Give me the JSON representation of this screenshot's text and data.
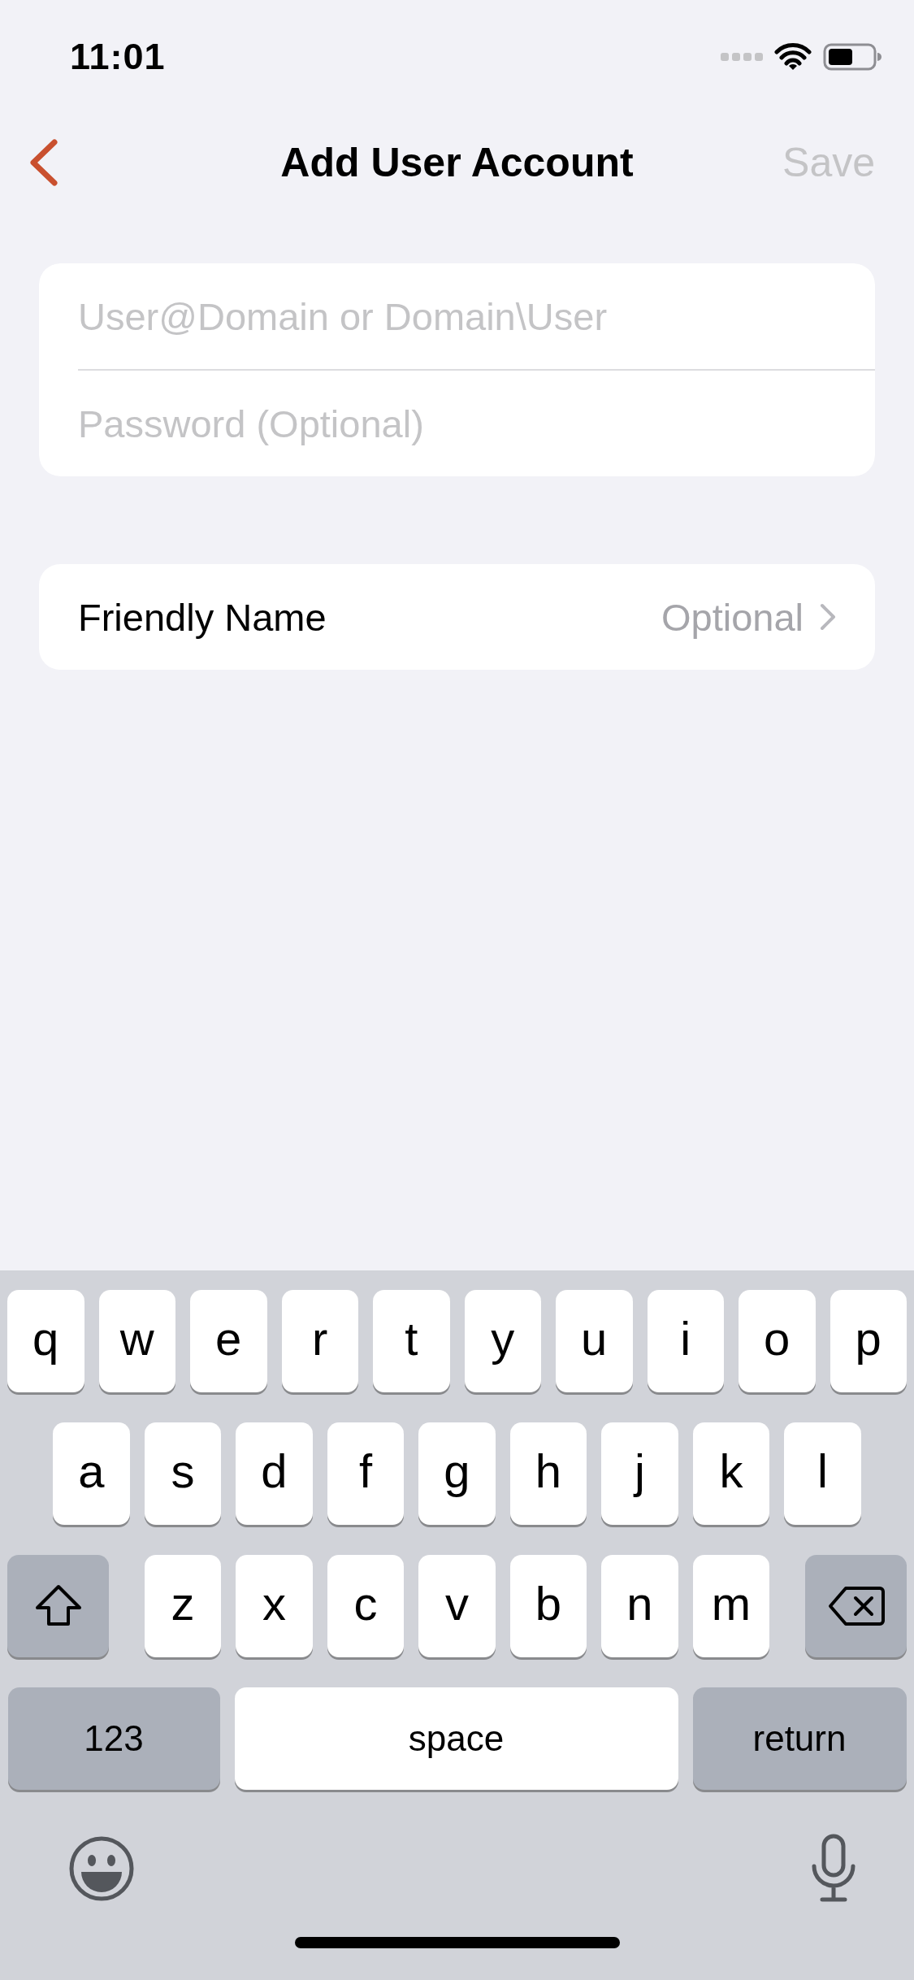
{
  "status_bar": {
    "time": "11:01"
  },
  "nav": {
    "title": "Add User Account",
    "save": {
      "label": "Save",
      "disabled": true
    }
  },
  "login_fields": [
    {
      "placeholder": "User@Domain or Domain\\User"
    },
    {
      "placeholder": "Password (Optional)"
    }
  ],
  "friendly_name": {
    "label": "Friendly Name",
    "placeholder": "Optional"
  },
  "keyboard": {
    "rows": [
      {
        "keys": [
          {
            "kind": "letter",
            "label": "q"
          },
          {
            "kind": "letter",
            "label": "w"
          },
          {
            "kind": "letter",
            "label": "e"
          },
          {
            "kind": "letter",
            "label": "r"
          },
          {
            "kind": "letter",
            "label": "t"
          },
          {
            "kind": "letter",
            "label": "y"
          },
          {
            "kind": "letter",
            "label": "u"
          },
          {
            "kind": "letter",
            "label": "i"
          },
          {
            "kind": "letter",
            "label": "o"
          },
          {
            "kind": "letter",
            "label": "p"
          }
        ]
      },
      {
        "keys": [
          {
            "kind": "letter",
            "label": "a"
          },
          {
            "kind": "letter",
            "label": "s"
          },
          {
            "kind": "letter",
            "label": "d"
          },
          {
            "kind": "letter",
            "label": "f"
          },
          {
            "kind": "letter",
            "label": "g"
          },
          {
            "kind": "letter",
            "label": "h"
          },
          {
            "kind": "letter",
            "label": "j"
          },
          {
            "kind": "letter",
            "label": "k"
          },
          {
            "kind": "letter",
            "label": "l"
          }
        ]
      },
      {
        "keys": [
          {
            "kind": "shift"
          },
          {
            "kind": "letter",
            "label": "z"
          },
          {
            "kind": "letter",
            "label": "x"
          },
          {
            "kind": "letter",
            "label": "c"
          },
          {
            "kind": "letter",
            "label": "v"
          },
          {
            "kind": "letter",
            "label": "b"
          },
          {
            "kind": "letter",
            "label": "n"
          },
          {
            "kind": "letter",
            "label": "m"
          },
          {
            "kind": "delete"
          }
        ]
      },
      {
        "keys": [
          {
            "kind": "numbers",
            "label": "123"
          },
          {
            "kind": "space",
            "label": "space"
          },
          {
            "kind": "return",
            "label": "return"
          }
        ]
      }
    ]
  }
}
